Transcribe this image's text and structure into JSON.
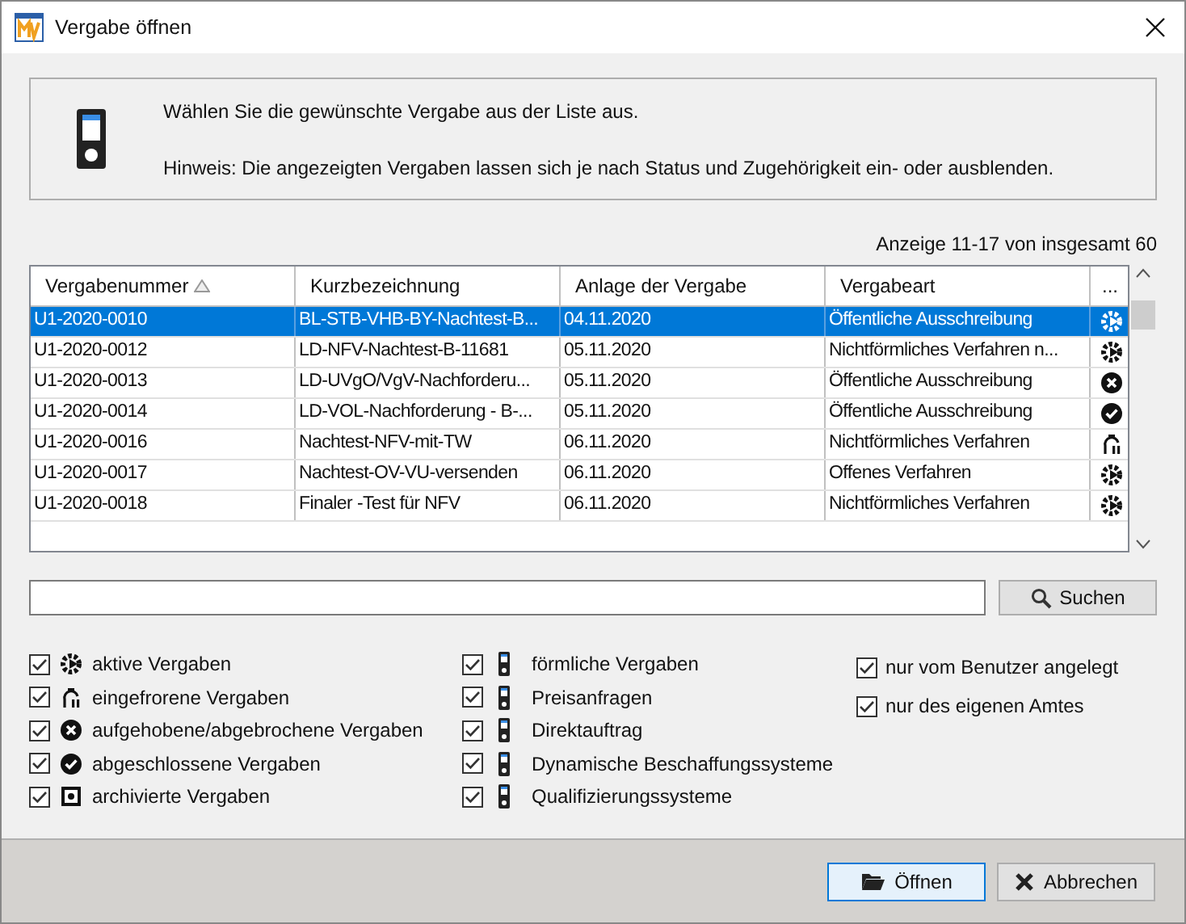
{
  "window": {
    "title": "Vergabe öffnen"
  },
  "info": {
    "lines": [
      "Wählen Sie die gewünschte Vergabe aus der Liste aus.",
      "Hinweis: Die angezeigten Vergaben lassen sich je nach Status und Zugehörigkeit ein- oder ausblenden."
    ]
  },
  "paging": "Anzeige 11-17 von insgesamt 60",
  "table": {
    "columns": [
      {
        "label": "Vergabenummer",
        "sorted": true
      },
      {
        "label": "Kurzbezeichnung",
        "sorted": false
      },
      {
        "label": "Anlage der Vergabe",
        "sorted": false
      },
      {
        "label": "Vergabeart",
        "sorted": false
      },
      {
        "label": "...",
        "sorted": false
      }
    ],
    "rows": [
      {
        "cells": [
          "U1-2020-0010",
          "BL-STB-VHB-BY-Nachtest-B...",
          "04.11.2020",
          "Öffentliche Ausschreibung"
        ],
        "kind": "active",
        "selected": true
      },
      {
        "cells": [
          "U1-2020-0012",
          "LD-NFV-Nachtest-B-11681",
          "05.11.2020",
          "Nichtförmliches Verfahren n..."
        ],
        "kind": "active",
        "selected": false
      },
      {
        "cells": [
          "U1-2020-0013",
          "LD-UVgO/VgV-Nachforderu...",
          "05.11.2020",
          "Öffentliche Ausschreibung"
        ],
        "kind": "cancelled",
        "selected": false
      },
      {
        "cells": [
          "U1-2020-0014",
          "LD-VOL-Nachforderung - B-...",
          "05.11.2020",
          "Öffentliche Ausschreibung"
        ],
        "kind": "completed",
        "selected": false
      },
      {
        "cells": [
          "U1-2020-0016",
          "Nachtest-NFV-mit-TW",
          "06.11.2020",
          "Nichtförmliches Verfahren"
        ],
        "kind": "frozen",
        "selected": false
      },
      {
        "cells": [
          "U1-2020-0017",
          "Nachtest-OV-VU-versenden",
          "06.11.2020",
          "Offenes Verfahren"
        ],
        "kind": "active",
        "selected": false
      },
      {
        "cells": [
          "U1-2020-0018",
          "Finaler -Test für NFV",
          "06.11.2020",
          "Nichtförmliches Verfahren"
        ],
        "kind": "active",
        "selected": false
      }
    ]
  },
  "search": {
    "button": "Suchen"
  },
  "filters": [
    [
      {
        "label": "aktive Vergaben",
        "kind": "active",
        "checked": true
      },
      {
        "label": "eingefrorene Vergaben",
        "kind": "frozen",
        "checked": true
      },
      {
        "label": "aufgehobene/abgebrochene Vergaben",
        "kind": "cancelled",
        "checked": true
      },
      {
        "label": "abgeschlossene Vergaben",
        "kind": "completed",
        "checked": true
      },
      {
        "label": "archivierte Vergaben",
        "kind": "archived",
        "checked": true
      }
    ],
    [
      {
        "label": "förmliche Vergaben",
        "kind": "device",
        "checked": true
      },
      {
        "label": "Preisanfragen",
        "kind": "device",
        "checked": true
      },
      {
        "label": "Direktauftrag",
        "kind": "device",
        "checked": true
      },
      {
        "label": "Dynamische Beschaffungssysteme",
        "kind": "device",
        "checked": true
      },
      {
        "label": "Qualifizierungssysteme",
        "kind": "device",
        "checked": true
      }
    ],
    [
      {
        "label": "nur vom Benutzer angelegt",
        "kind": "plain",
        "checked": true
      },
      {
        "label": "nur des eigenen Amtes",
        "kind": "plain",
        "checked": true
      }
    ]
  ],
  "buttons": [
    {
      "label": "Öffnen",
      "kind": "open"
    },
    {
      "label": "Abbrechen",
      "kind": "cancel"
    }
  ]
}
